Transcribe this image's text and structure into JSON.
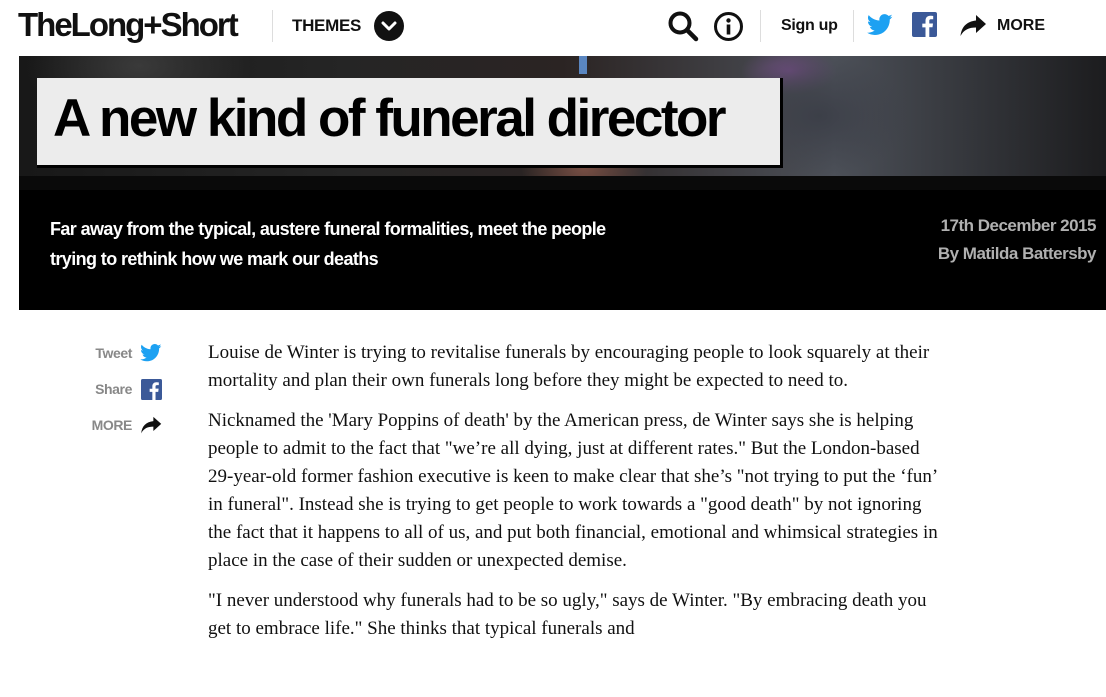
{
  "header": {
    "logo": "TheLong+Short",
    "themes_label": "THEMES",
    "signup_label": "Sign up",
    "more_label": "MORE",
    "icons": [
      "chevron-down-icon",
      "search-icon",
      "info-icon",
      "twitter-icon",
      "facebook-icon",
      "share-arrow-icon"
    ]
  },
  "hero": {
    "title": "A new kind of funeral director",
    "standfirst": "Far away from the typical, austere funeral formalities, meet the people trying to rethink how we mark our deaths",
    "date": "17th December 2015",
    "byline": "By Matilda Battersby"
  },
  "share": {
    "tweet_label": "Tweet",
    "share_label": "Share",
    "more_label": "MORE"
  },
  "article": {
    "paragraphs": [
      "Louise de Winter is trying to revitalise funerals by encouraging people to look squarely at their mortality and plan their own funerals long before they might be expected to need to.",
      "Nicknamed the 'Mary Poppins of death' by the American press, de Winter says she is helping people to admit to the fact that \"we’re all dying, just at different rates.\" But the London-based 29-year-old former fashion executive is keen to make clear that she’s \"not trying to put the ‘fun’ in funeral\". Instead she is trying to get people to work towards a \"good death\" by not ignoring the fact that it happens to all of us, and put both financial, emotional and whimsical strategies in place in the case of their sudden or unexpected demise.",
      "\"I never understood why funerals had to be so ugly,\" says de Winter. \"By embracing death you get to embrace life.\" She thinks that typical funerals and"
    ]
  },
  "colors": {
    "twitter": "#1da1f2",
    "facebook": "#3b5998",
    "hero_bg": "#000000",
    "title_box": "#ececec",
    "meta_text": "#b0b0b0"
  }
}
